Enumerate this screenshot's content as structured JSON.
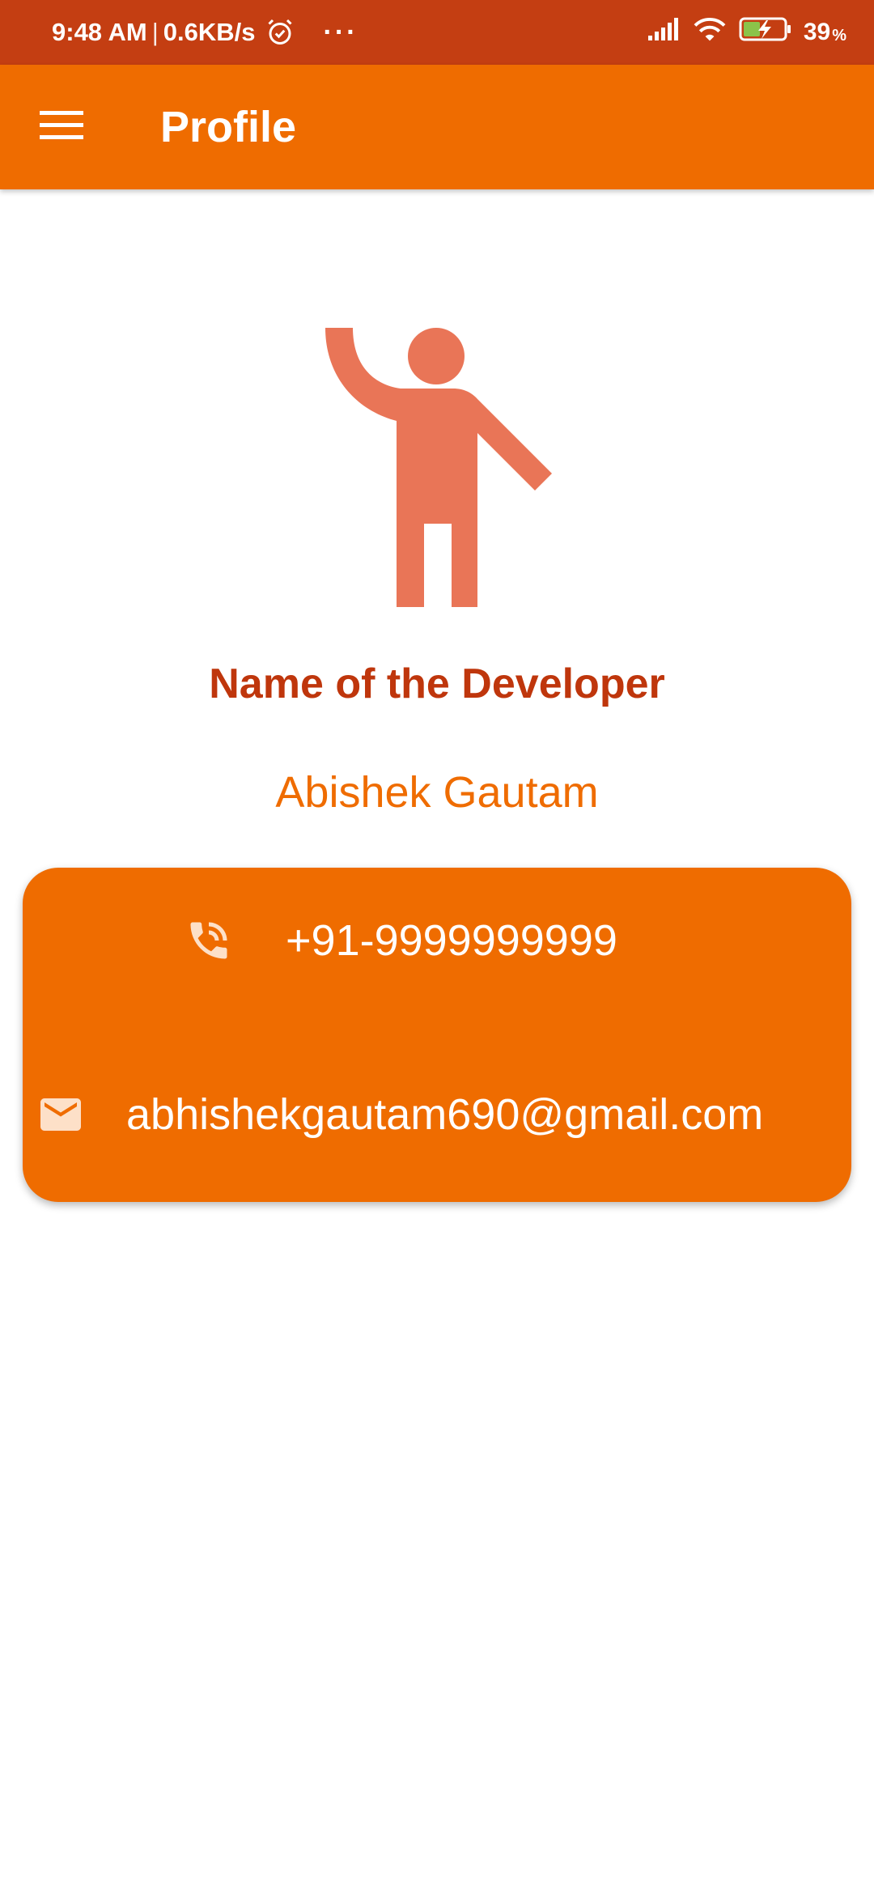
{
  "status_bar": {
    "time": "9:48 AM",
    "separator": "|",
    "network_speed": "0.6KB/s",
    "more": "···",
    "battery_level": "39",
    "battery_unit": "%",
    "icons": [
      "alarm-icon",
      "signal-icon",
      "wifi-icon",
      "battery-charging-icon"
    ]
  },
  "app_bar": {
    "title": "Profile",
    "menu_icon": "hamburger-menu-icon"
  },
  "profile": {
    "avatar_icon": "person-waving-icon",
    "heading": "Name of the Developer",
    "name": "Abishek Gautam"
  },
  "contact": {
    "phone": "+91-9999999999",
    "phone_icon": "phone-in-talk-icon",
    "email": "abhishekgautam690@gmail.com",
    "email_icon": "email-icon"
  },
  "colors": {
    "status_bar": "#c43e12",
    "app_bar": "#ef6c00",
    "heading": "#bf360c",
    "name": "#ef6c00",
    "avatar": "#e97557",
    "card": "#ef6c00",
    "email_icon": "#fde0c8"
  }
}
